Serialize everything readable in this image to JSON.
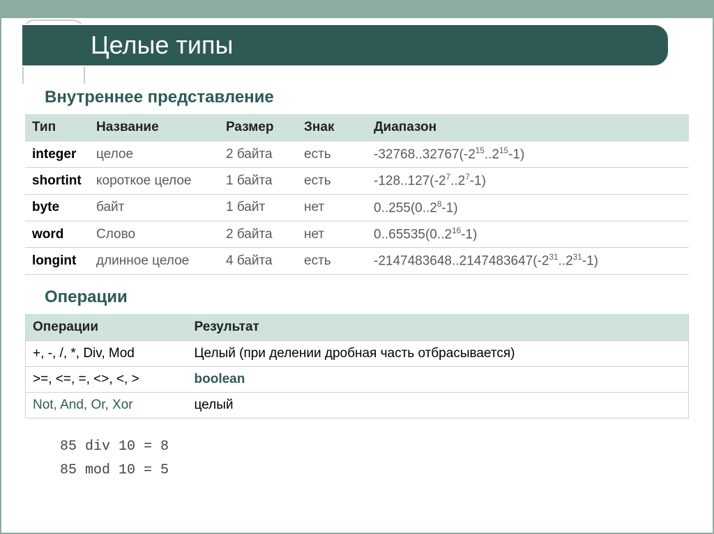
{
  "title": "Целые типы",
  "section1": "Внутреннее представление",
  "section2": "Операции",
  "table1": {
    "headers": [
      "Тип",
      "Название",
      "Размер",
      "Знак",
      "Диапазон"
    ],
    "rows": [
      {
        "type": "integer",
        "name": "целое",
        "size": "2 байта",
        "sign": "есть",
        "range_a": "-32768..32767(-2",
        "sup1": "15",
        "range_b": "..2",
        "sup2": "15",
        "range_c": "-1)"
      },
      {
        "type": "shortint",
        "name": "короткое целое",
        "size": "1 байта",
        "sign": "есть",
        "range_a": "-128..127(-2",
        "sup1": "7",
        "range_b": "..2",
        "sup2": "7",
        "range_c": "-1)"
      },
      {
        "type": "byte",
        "name": "байт",
        "size": "1 байт",
        "sign": "нет",
        "range_a": "0..255(0..2",
        "sup1": "8",
        "range_b": "-1)",
        "sup2": "",
        "range_c": ""
      },
      {
        "type": "word",
        "name": "Слово",
        "size": "2 байта",
        "sign": "нет",
        "range_a": "0..65535(0..2",
        "sup1": "16",
        "range_b": "-1)",
        "sup2": "",
        "range_c": ""
      },
      {
        "type": "longint",
        "name": "длинное целое",
        "size": "4 байта",
        "sign": "есть",
        "range_a": "-2147483648..2147483647(-2",
        "sup1": "31",
        "range_b": "..2",
        "sup2": "31",
        "range_c": "-1)"
      }
    ]
  },
  "table2": {
    "headers": [
      "Операции",
      "Результат"
    ],
    "rows": [
      {
        "op": "+, -, /, *, Div, Mod",
        "res": "Целый (при делении дробная часть отбрасывается)",
        "style": "plain"
      },
      {
        "op": ">=, <=, =, <>, <, >",
        "res": "boolean",
        "style": "teal"
      },
      {
        "op": "Not, And, Or, Xor",
        "res": "целый",
        "style": "opgray"
      }
    ]
  },
  "examples": {
    "line1": "85 div 10 = 8",
    "line2": "85 mod 10 = 5"
  }
}
